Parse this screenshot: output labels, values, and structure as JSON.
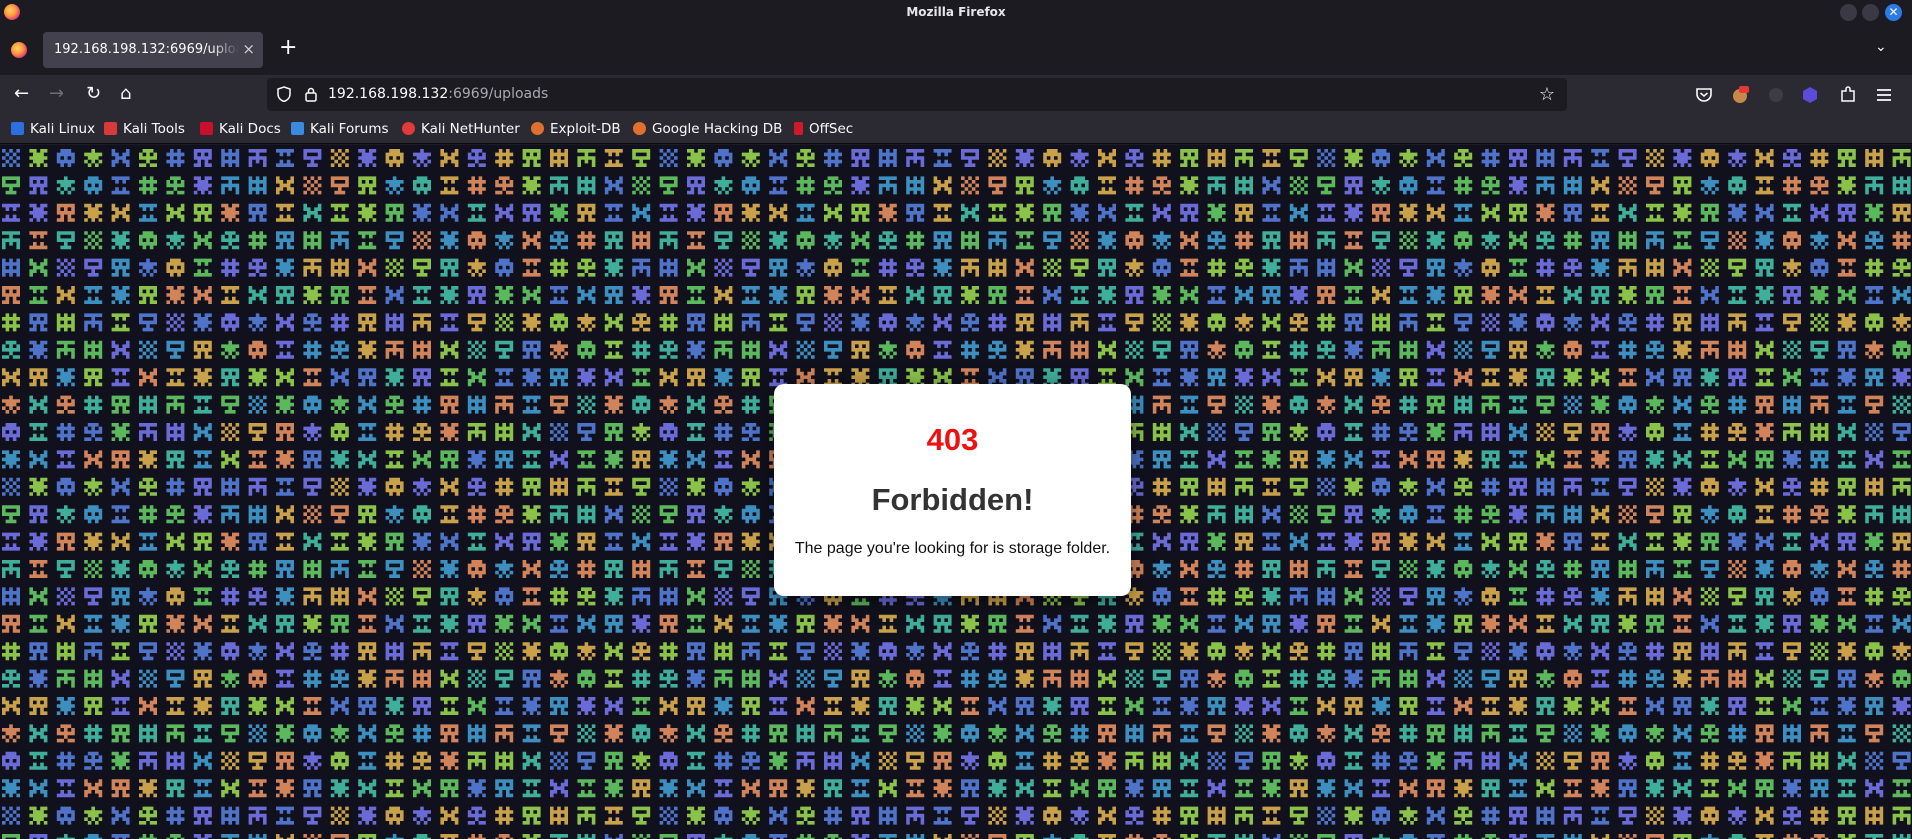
{
  "window": {
    "title": "Mozilla Firefox"
  },
  "tabs": [
    {
      "label": "192.168.198.132:6969/uploads",
      "close": "×"
    }
  ],
  "toolbar": {
    "new_tab": "+",
    "tab_list": "⌄",
    "back": "←",
    "forward": "→",
    "reload": "↻",
    "home": "⌂"
  },
  "urlbar": {
    "host": "192.168.198.132",
    "path": ":6969/uploads",
    "bookmark_star": "☆"
  },
  "bookmarks": [
    {
      "label": "Kali Linux",
      "color": "#2d6fe0"
    },
    {
      "label": "Kali Tools",
      "color": "#d83a3a"
    },
    {
      "label": "Kali Docs",
      "color": "#c8102e"
    },
    {
      "label": "Kali Forums",
      "color": "#3a8be0"
    },
    {
      "label": "Kali NetHunter",
      "color": "#e03a3a"
    },
    {
      "label": "Exploit-DB",
      "color": "#e07030"
    },
    {
      "label": "Google Hacking DB",
      "color": "#e07030"
    },
    {
      "label": "OffSec",
      "color": "#d01a2a"
    }
  ],
  "error": {
    "code": "403",
    "title": "Forbidden!",
    "message": "The page you're looking for is storage folder."
  },
  "theme": {
    "background": "#10111d",
    "pattern_colors": [
      "#4f73c9",
      "#3fae9a",
      "#8bc34a",
      "#d1845a",
      "#c9a14a",
      "#3d8fc0",
      "#6a6bd6",
      "#5cb85c"
    ]
  }
}
